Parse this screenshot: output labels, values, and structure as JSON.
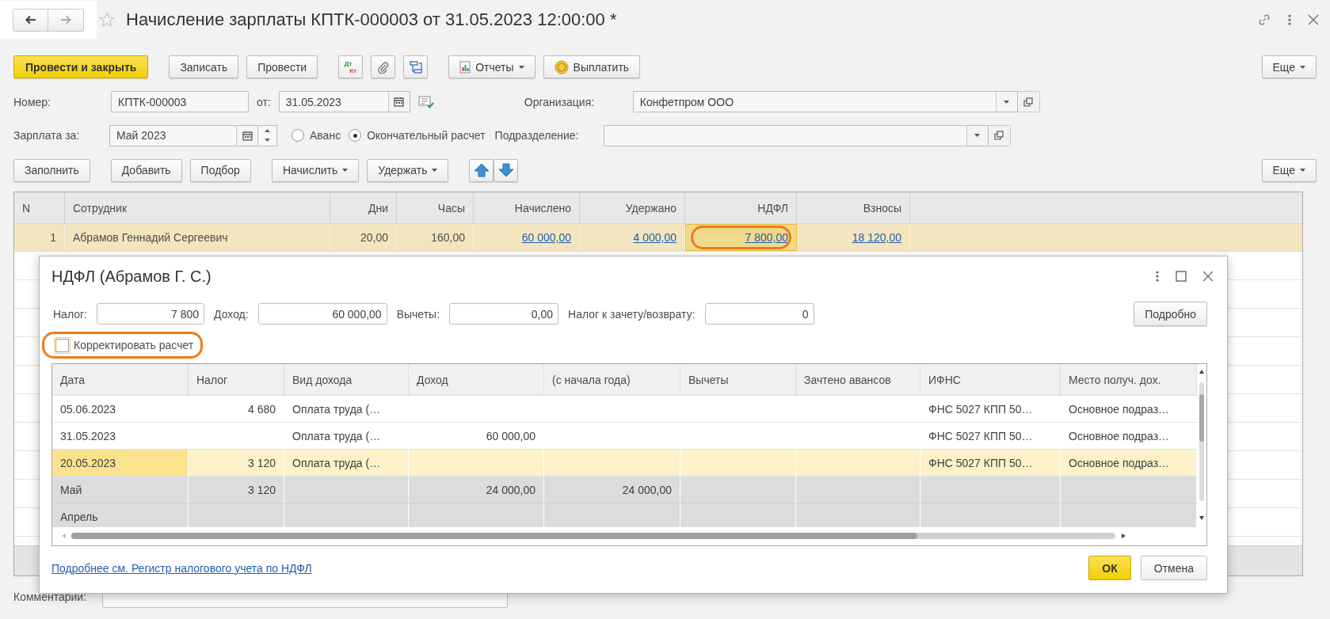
{
  "window": {
    "title": "Начисление зарплаты КПТК-000003 от 31.05.2023 12:00:00 *",
    "favorite": false
  },
  "toolbar": {
    "buttons": [
      {
        "kind": "primary",
        "label": "Провести и закрыть"
      },
      {
        "kind": "text",
        "label": "Записать"
      },
      {
        "kind": "text",
        "label": "Провести"
      },
      {
        "kind": "dtkt",
        "top": "Дт",
        "bottom": "Кт"
      },
      {
        "kind": "clip"
      },
      {
        "kind": "structure"
      },
      {
        "kind": "report",
        "label": "Отчеты",
        "menu": true
      },
      {
        "kind": "coin",
        "label": "Выплатить"
      }
    ],
    "more": {
      "label": "Еще",
      "menu": true
    }
  },
  "header": {
    "number": {
      "label": "Номер:",
      "value": "КПТК-000003"
    },
    "date": {
      "label": "от:",
      "value": "31.05.2023"
    },
    "organization": {
      "label": "Организация:",
      "value": "Конфетпром ООО"
    },
    "period": {
      "label": "Зарплата за:",
      "value": "Май 2023"
    },
    "payment_type": [
      {
        "label": "Аванс",
        "selected": false
      },
      {
        "label": "Окончательный расчет",
        "selected": true
      }
    ],
    "department": {
      "label": "Подразделение:"
    }
  },
  "table_toolbar": {
    "buttons": [
      {
        "kind": "text",
        "label": "Заполнить"
      },
      {
        "kind": "text",
        "label": "Добавить"
      },
      {
        "kind": "text",
        "label": "Подбор"
      },
      {
        "kind": "text",
        "label": "Начислить",
        "menu": true
      },
      {
        "kind": "text",
        "label": "Удержать",
        "menu": true
      },
      {
        "kind": "up"
      },
      {
        "kind": "down"
      }
    ],
    "more": {
      "label": "Еще",
      "menu": true
    }
  },
  "table": {
    "columns": [
      {
        "label": "N"
      },
      {
        "label": "Сотрудник"
      },
      {
        "label": "Дни"
      },
      {
        "label": "Часы"
      },
      {
        "label": "Начислено"
      },
      {
        "label": "Удержано"
      },
      {
        "label": "НДФЛ"
      },
      {
        "label": "Взносы"
      }
    ],
    "rows": [
      {
        "selected": true,
        "cells": [
          {
            "text": "1",
            "link": false
          },
          {
            "text": "Абрамов Геннадий Сергеевич",
            "link": false
          },
          {
            "text": "20,00",
            "link": false
          },
          {
            "text": "160,00",
            "link": false
          },
          {
            "text": "60 000,00",
            "link": true
          },
          {
            "text": "4 000,00",
            "link": true
          },
          {
            "text": "7 800,00",
            "link": true,
            "current": true,
            "highlighted": true
          },
          {
            "text": "18 120,00",
            "link": true
          }
        ]
      }
    ]
  },
  "comment": {
    "label": "Комментарий:"
  },
  "dialog": {
    "title": "НДФЛ (Абрамов Г. С.)",
    "fields": [
      {
        "label": "Налог:",
        "value": "7 800"
      },
      {
        "label": "Доход:",
        "value": "60 000,00"
      },
      {
        "label": "Вычеты:",
        "value": "0,00"
      },
      {
        "label": "Налог к зачету/возврату:",
        "value": "0"
      }
    ],
    "details_button": "Подробно",
    "checkbox": {
      "label": "Корректировать расчет",
      "checked": false,
      "highlighted": true
    },
    "table": {
      "columns": [
        {
          "label": "Дата"
        },
        {
          "label": "Налог"
        },
        {
          "label": "Вид дохода"
        },
        {
          "label": "Доход"
        },
        {
          "label": "(с начала года)"
        },
        {
          "label": "Вычеты"
        },
        {
          "label": "Зачтено авансов"
        },
        {
          "label": "ИФНС"
        },
        {
          "label": "Место получ. дох."
        }
      ],
      "rows": [
        {
          "kind": "entry",
          "selected": false,
          "cells": [
            "05.06.2023",
            "4 680",
            "Оплата труда (…",
            null,
            null,
            null,
            null,
            "ФНС 5027 КПП 50…",
            "Основное подраз…"
          ]
        },
        {
          "kind": "entry",
          "selected": false,
          "cells": [
            "31.05.2023",
            null,
            "Оплата труда (…",
            "60 000,00",
            null,
            null,
            null,
            "ФНС 5027 КПП 50…",
            "Основное подраз…"
          ]
        },
        {
          "kind": "entry",
          "selected": true,
          "cells": [
            "20.05.2023",
            "3 120",
            "Оплата труда (…",
            null,
            null,
            null,
            null,
            "ФНС 5027 КПП 50…",
            "Основное подраз…"
          ]
        },
        {
          "kind": "total",
          "selected": false,
          "cells": [
            "Май",
            "3 120",
            null,
            "24 000,00",
            "24 000,00",
            null,
            null,
            null,
            null
          ]
        },
        {
          "kind": "total",
          "selected": false,
          "cells": [
            "Апрель",
            null,
            null,
            null,
            null,
            null,
            null,
            null,
            null
          ]
        }
      ]
    },
    "link": "Подробнее см. Регистр налогового учета по НДФЛ",
    "ok": "ОК",
    "cancel": "Отмена"
  }
}
